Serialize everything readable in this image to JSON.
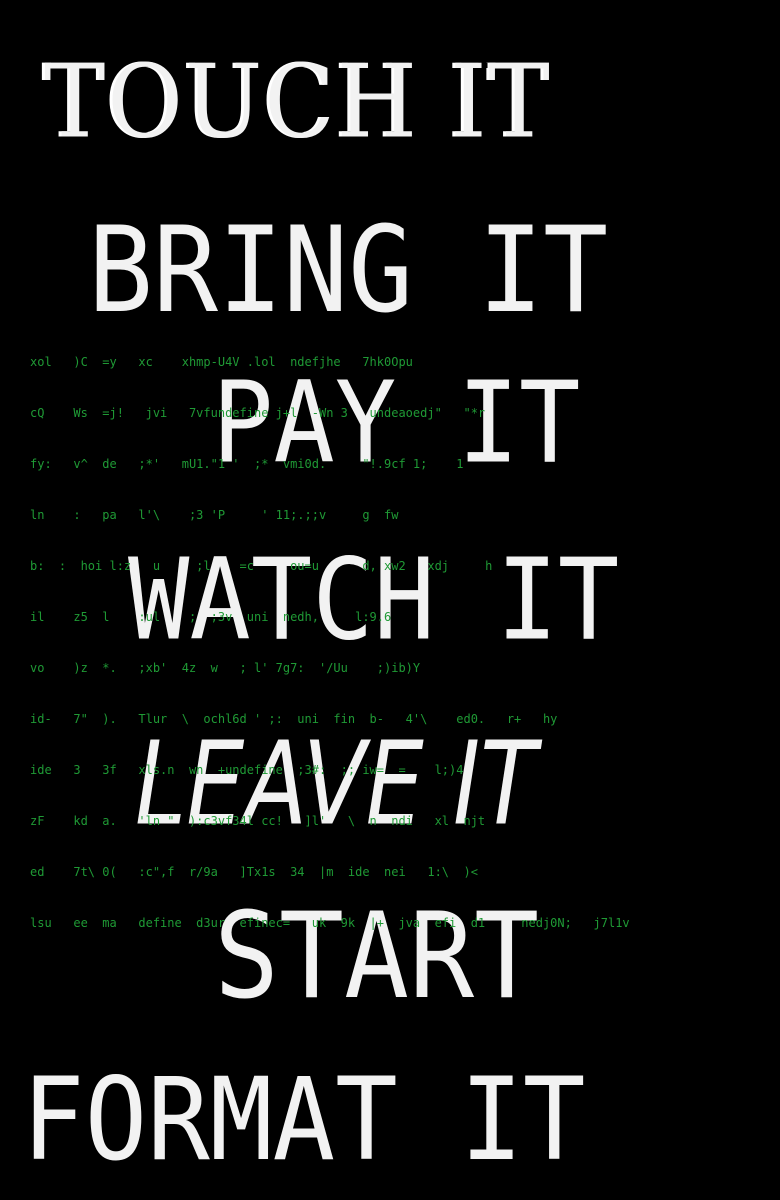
{
  "menu": [
    {
      "label": "TOUCH IT"
    },
    {
      "label": "BRING IT"
    },
    {
      "label": "PAY IT"
    },
    {
      "label": "WATCH IT"
    },
    {
      "label": "LEAVE IT"
    },
    {
      "label": "START"
    },
    {
      "label": "FORMAT IT"
    }
  ],
  "matrix_lines": [
    "xol   )C  =y   xc    xhmp-U4V .lol  ndefjhe   7hk0Opu",
    "cQ    Ws  =j!   jvi   7vfundefine j+l  -Wn 3   undeaoedj\"   \"*r",
    "fy:   v^  de   ;*'   mU1.\"1 '  ;*  vmi0d.     \"!.9cf 1;    1",
    "ln    :   pa   l'\\    ;3 'P     ' 11;.;;v     g  fw",
    "b:  :  hoi l:z   u     ;l    =c     ou=u      d, xw2   xdj     h",
    "il    z5  l    :ul    ;  ;3v  uni  nedh,     l:9.6",
    "vo    )z  *.   ;xb'  4z  w   ; l' 7g7:  '/Uu    ;)ib)Y",
    "id-   7\"  ).   Tlur  \\  ochl6d ' ;:  uni  fin  b-   4'\\    ed0.   r+   hy",
    "ide   3   3f   xls.n  wn  +undefine  ;3#:  ;; iw=  =    l;)4",
    "zF    kd  a.   'ln \"  ):c3vf34l cc!   ]l'   \\  n  ndi   xl  njt",
    "ed    7t\\ 0(   :c\",f  r/9a   ]Tx1s  34  |m  ide  nei   1:\\  )<",
    "lsu   ee  ma   define  d3ur  efinec=   uk  9k  |+  jva  efi  d1     nedj0N;   j7l1v"
  ]
}
